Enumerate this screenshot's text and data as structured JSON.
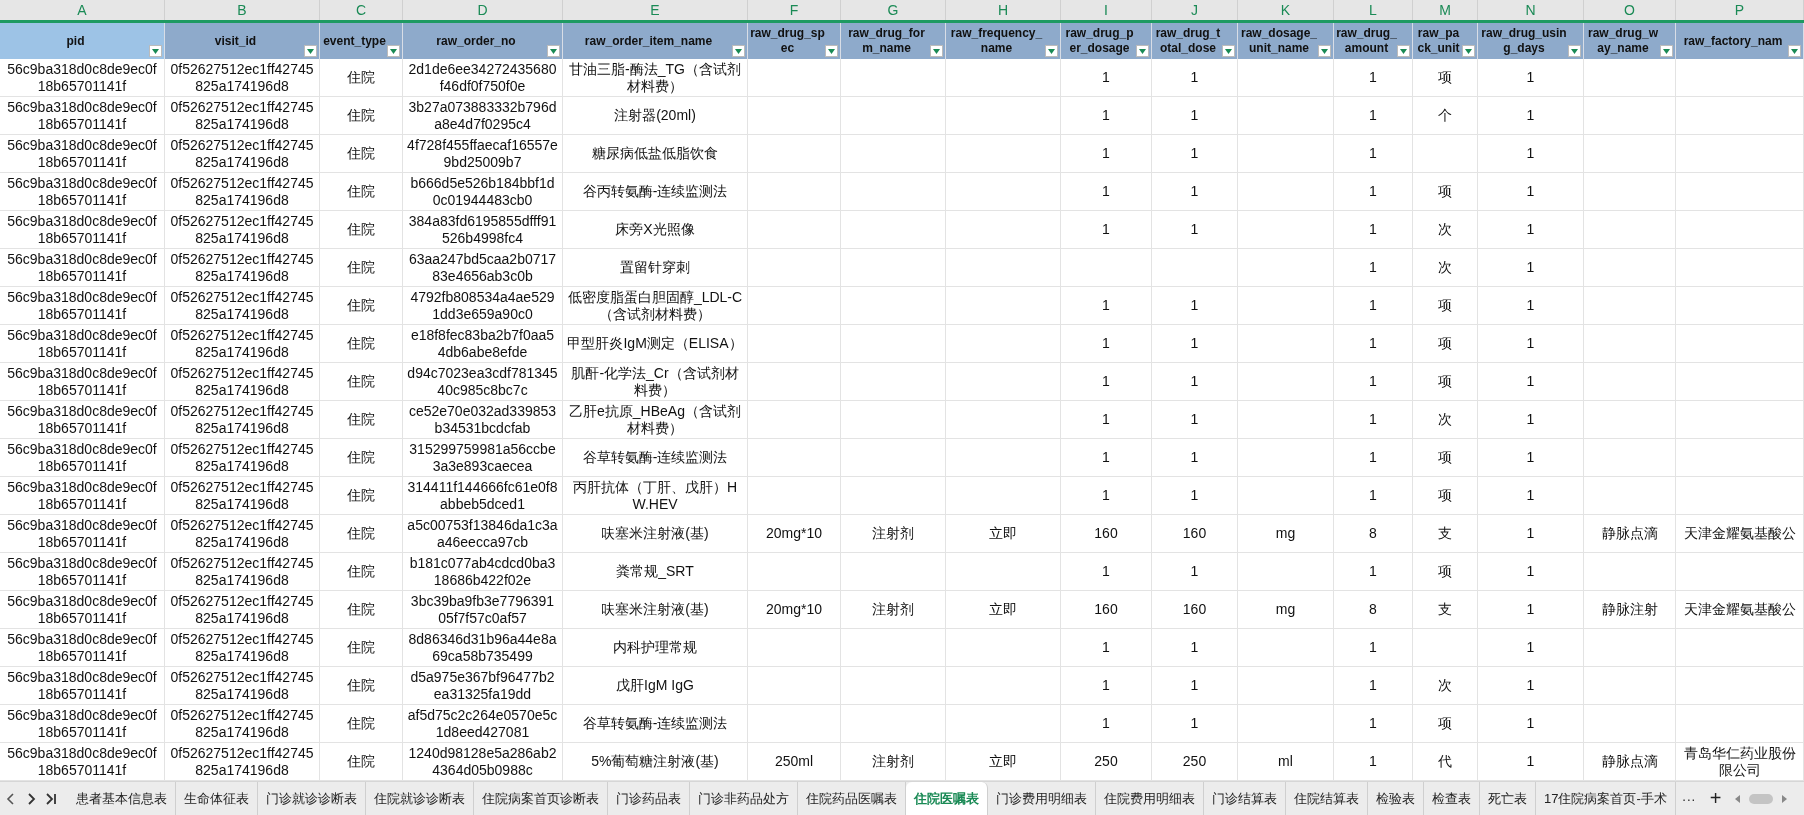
{
  "column_letters": [
    "A",
    "B",
    "C",
    "D",
    "E",
    "F",
    "G",
    "H",
    "I",
    "J",
    "K",
    "L",
    "M",
    "N",
    "O",
    "P"
  ],
  "columns": [
    {
      "label": "pid",
      "selected": true
    },
    {
      "label": "visit_id",
      "selected": false
    },
    {
      "label": "event_type",
      "selected": false
    },
    {
      "label": "raw_order_no",
      "selected": false
    },
    {
      "label": "raw_order_item_name",
      "selected": false
    },
    {
      "label": "raw_drug_spec",
      "selected": false
    },
    {
      "label": "raw_drug_form_name",
      "selected": false
    },
    {
      "label": "raw_frequency_name",
      "selected": false
    },
    {
      "label": "raw_drug_per_dosage",
      "selected": false
    },
    {
      "label": "raw_drug_total_dose",
      "selected": false
    },
    {
      "label": "raw_dosage_unit_name",
      "selected": false
    },
    {
      "label": "raw_drug_amount",
      "selected": false
    },
    {
      "label": "raw_pack_unit",
      "selected": false
    },
    {
      "label": "raw_drug_using_days",
      "selected": false
    },
    {
      "label": "raw_drug_way_name",
      "selected": false
    },
    {
      "label": "raw_factory_nam",
      "selected": false
    }
  ],
  "rows": [
    {
      "cells": [
        "56c9ba318d0c8de9ec0f18b65701141f",
        "0f52627512ec1ff42745825a174196d8",
        "住院",
        "2d1de6ee34272435680f46df0f750f0e",
        "甘油三脂-酶法_TG（含试剂材料费）",
        null,
        null,
        null,
        "1",
        "1",
        null,
        "1",
        "项",
        "1",
        null,
        null
      ]
    },
    {
      "cells": [
        "56c9ba318d0c8de9ec0f18b65701141f",
        "0f52627512ec1ff42745825a174196d8",
        "住院",
        "3b27a073883332b796da8e4d7f0295c4",
        "注射器(20ml)",
        null,
        null,
        null,
        "1",
        "1",
        null,
        "1",
        "个",
        "1",
        null,
        null
      ]
    },
    {
      "cells": [
        "56c9ba318d0c8de9ec0f18b65701141f",
        "0f52627512ec1ff42745825a174196d8",
        "住院",
        "4f728f455ffaecaf16557e9bd25009b7",
        "糖尿病低盐低脂饮食",
        null,
        null,
        null,
        "1",
        "1",
        null,
        "1",
        null,
        "1",
        null,
        null
      ]
    },
    {
      "cells": [
        "56c9ba318d0c8de9ec0f18b65701141f",
        "0f52627512ec1ff42745825a174196d8",
        "住院",
        "b666d5e526b184bbf1d0c01944483cb0",
        "谷丙转氨酶-连续监测法",
        null,
        null,
        null,
        "1",
        "1",
        null,
        "1",
        "项",
        "1",
        null,
        null
      ]
    },
    {
      "cells": [
        "56c9ba318d0c8de9ec0f18b65701141f",
        "0f52627512ec1ff42745825a174196d8",
        "住院",
        "384a83fd6195855dfff91526b4998fc4",
        "床旁X光照像",
        null,
        null,
        null,
        "1",
        "1",
        null,
        "1",
        "次",
        "1",
        null,
        null
      ]
    },
    {
      "cells": [
        "56c9ba318d0c8de9ec0f18b65701141f",
        "0f52627512ec1ff42745825a174196d8",
        "住院",
        "63aa247bd5caa2b071783e4656ab3c0b",
        "置留针穿刺",
        null,
        null,
        null,
        null,
        null,
        null,
        "1",
        "次",
        "1",
        null,
        null
      ]
    },
    {
      "cells": [
        "56c9ba318d0c8de9ec0f18b65701141f",
        "0f52627512ec1ff42745825a174196d8",
        "住院",
        "4792fb808534a4ae5291dd3e659a90c0",
        "低密度脂蛋白胆固醇_LDL-C（含试剂材料费）",
        null,
        null,
        null,
        "1",
        "1",
        null,
        "1",
        "项",
        "1",
        null,
        null
      ]
    },
    {
      "cells": [
        "56c9ba318d0c8de9ec0f18b65701141f",
        "0f52627512ec1ff42745825a174196d8",
        "住院",
        "e18f8fec83ba2b7f0aa54db6abe8efde",
        "甲型肝炎IgM测定（ELISA）",
        null,
        null,
        null,
        "1",
        "1",
        null,
        "1",
        "项",
        "1",
        null,
        null
      ]
    },
    {
      "cells": [
        "56c9ba318d0c8de9ec0f18b65701141f",
        "0f52627512ec1ff42745825a174196d8",
        "住院",
        "d94c7023ea3cdf78134540c985c8bc7c",
        "肌酐-化学法_Cr（含试剂材料费）",
        null,
        null,
        null,
        "1",
        "1",
        null,
        "1",
        "项",
        "1",
        null,
        null
      ]
    },
    {
      "cells": [
        "56c9ba318d0c8de9ec0f18b65701141f",
        "0f52627512ec1ff42745825a174196d8",
        "住院",
        "ce52e70e032ad339853b34531bcdcfab",
        "乙肝e抗原_HBeAg（含试剂材料费）",
        null,
        null,
        null,
        "1",
        "1",
        null,
        "1",
        "次",
        "1",
        null,
        null
      ]
    },
    {
      "cells": [
        "56c9ba318d0c8de9ec0f18b65701141f",
        "0f52627512ec1ff42745825a174196d8",
        "住院",
        "315299759981a56ccbe3a3e893caecea",
        "谷草转氨酶-连续监测法",
        null,
        null,
        null,
        "1",
        "1",
        null,
        "1",
        "项",
        "1",
        null,
        null
      ]
    },
    {
      "cells": [
        "56c9ba318d0c8de9ec0f18b65701141f",
        "0f52627512ec1ff42745825a174196d8",
        "住院",
        "314411f144666fc61e0f8abbeb5dced1",
        "丙肝抗体（丁肝、戊肝）HW.HEV",
        null,
        null,
        null,
        "1",
        "1",
        null,
        "1",
        "项",
        "1",
        null,
        null
      ]
    },
    {
      "cells": [
        "56c9ba318d0c8de9ec0f18b65701141f",
        "0f52627512ec1ff42745825a174196d8",
        "住院",
        "a5c00753f13846da1c3aa46eecca97cb",
        "呋塞米注射液(基)",
        "20mg*10",
        "注射剂",
        "立即",
        "160",
        "160",
        "mg",
        "8",
        "支",
        "1",
        "静脉点滴",
        "天津金耀氨基酸公"
      ]
    },
    {
      "cells": [
        "56c9ba318d0c8de9ec0f18b65701141f",
        "0f52627512ec1ff42745825a174196d8",
        "住院",
        "b181c077ab4cdcd0ba318686b422f02e",
        "粪常规_SRT",
        null,
        null,
        null,
        "1",
        "1",
        null,
        "1",
        "项",
        "1",
        null,
        null
      ]
    },
    {
      "cells": [
        "56c9ba318d0c8de9ec0f18b65701141f",
        "0f52627512ec1ff42745825a174196d8",
        "住院",
        "3bc39ba9fb3e779639105f7f57c0af57",
        "呋塞米注射液(基)",
        "20mg*10",
        "注射剂",
        "立即",
        "160",
        "160",
        "mg",
        "8",
        "支",
        "1",
        "静脉注射",
        "天津金耀氨基酸公"
      ]
    },
    {
      "cells": [
        "56c9ba318d0c8de9ec0f18b65701141f",
        "0f52627512ec1ff42745825a174196d8",
        "住院",
        "8d86346d31b96a44e8a69ca58b735499",
        "内科护理常规",
        null,
        null,
        null,
        "1",
        "1",
        null,
        "1",
        null,
        "1",
        null,
        null
      ]
    },
    {
      "cells": [
        "56c9ba318d0c8de9ec0f18b65701141f",
        "0f52627512ec1ff42745825a174196d8",
        "住院",
        "d5a975e367bf96477b2ea31325fa19dd",
        "戊肝IgM IgG",
        null,
        null,
        null,
        "1",
        "1",
        null,
        "1",
        "次",
        "1",
        null,
        null
      ]
    },
    {
      "cells": [
        "56c9ba318d0c8de9ec0f18b65701141f",
        "0f52627512ec1ff42745825a174196d8",
        "住院",
        "af5d75c2c264e0570e5c1d8eed427081",
        "谷草转氨酶-连续监测法",
        null,
        null,
        null,
        "1",
        "1",
        null,
        "1",
        "项",
        "1",
        null,
        null
      ]
    },
    {
      "cells": [
        "56c9ba318d0c8de9ec0f18b65701141f",
        "0f52627512ec1ff42745825a174196d8",
        "住院",
        "1240d98128e5a286ab24364d05b0988c",
        "5%葡萄糖注射液(基)",
        "250ml",
        "注射剂",
        "立即",
        "250",
        "250",
        "ml",
        "1",
        "代",
        "1",
        "静脉点滴",
        "青岛华仁药业股份限公司"
      ]
    }
  ],
  "sheet_tabs": [
    {
      "label": "患者基本信息表",
      "selected": false
    },
    {
      "label": "生命体征表",
      "selected": false
    },
    {
      "label": "门诊就诊诊断表",
      "selected": false
    },
    {
      "label": "住院就诊诊断表",
      "selected": false
    },
    {
      "label": "住院病案首页诊断表",
      "selected": false
    },
    {
      "label": "门诊药品表",
      "selected": false
    },
    {
      "label": "门诊非药品处方",
      "selected": false
    },
    {
      "label": "住院药品医嘱表",
      "selected": false
    },
    {
      "label": "住院医嘱表",
      "selected": true
    },
    {
      "label": "门诊费用明细表",
      "selected": false
    },
    {
      "label": "住院费用明细表",
      "selected": false
    },
    {
      "label": "门诊结算表",
      "selected": false
    },
    {
      "label": "住院结算表",
      "selected": false
    },
    {
      "label": "检验表",
      "selected": false
    },
    {
      "label": "检查表",
      "selected": false
    },
    {
      "label": "死亡表",
      "selected": false
    },
    {
      "label": "17住院病案首页-手术",
      "selected": false
    }
  ],
  "tab_overflow": "···",
  "add_sheet": "+"
}
